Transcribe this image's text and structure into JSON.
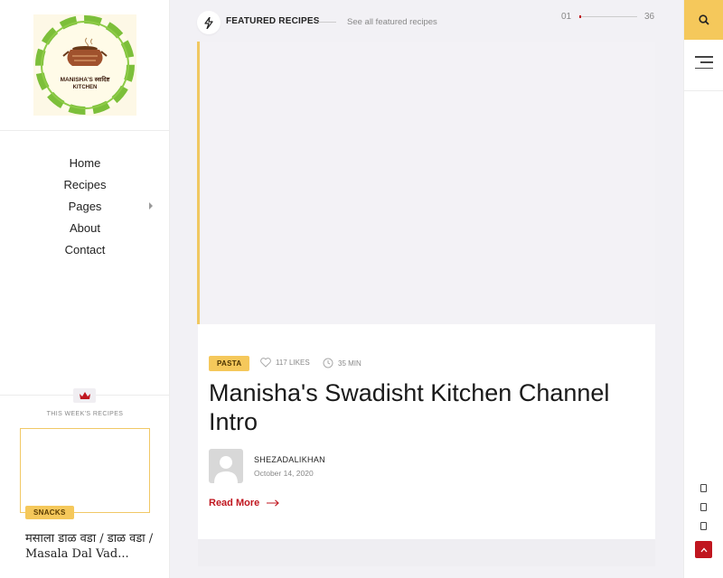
{
  "logo": {
    "line1": "MANISHA'S स्वादिष्ट",
    "line2": "KITCHEN"
  },
  "nav": {
    "items": [
      {
        "label": "Home"
      },
      {
        "label": "Recipes"
      },
      {
        "label": "Pages"
      },
      {
        "label": "About"
      },
      {
        "label": "Contact"
      }
    ]
  },
  "week": {
    "title": "THIS WEEK'S RECIPES",
    "badge": "SNACKS",
    "recipe_title": "मसाला डाळ वडा / डाळ वडा / Masala Dal Vad..."
  },
  "featured": {
    "title": "FEATURED RECIPES",
    "link": "See all featured recipes",
    "slider_start": "01",
    "slider_end": "36",
    "slider_progress": 0.028
  },
  "card": {
    "category": "PASTA",
    "likes": "117 LIKES",
    "time": "35 MIN",
    "title": "Manisha's Swadisht Kitchen Channel Intro",
    "author": "SHEZADALIKHAN",
    "date": "October 14, 2020",
    "read_more": "Read More"
  },
  "colors": {
    "accent": "#c0161f",
    "yellow": "#f5c85b",
    "logo_green": "#7cbf3a"
  }
}
